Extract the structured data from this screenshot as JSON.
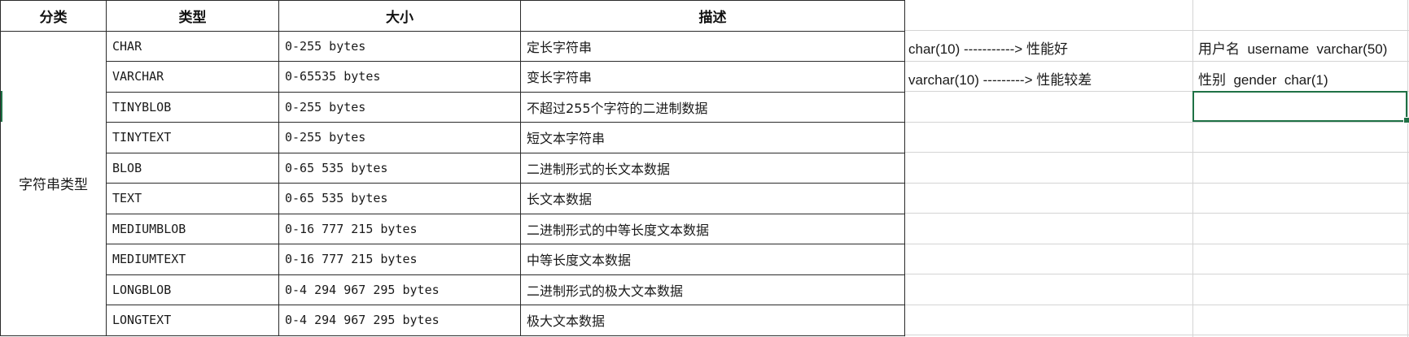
{
  "table": {
    "headers": [
      "分类",
      "类型",
      "大小",
      "描述"
    ],
    "category": "字符串类型",
    "rows": [
      {
        "type": "CHAR",
        "size": "0-255 bytes",
        "desc": "定长字符串"
      },
      {
        "type": "VARCHAR",
        "size": "0-65535 bytes",
        "desc": "变长字符串"
      },
      {
        "type": "TINYBLOB",
        "size": "0-255 bytes",
        "desc": "不超过255个字符的二进制数据"
      },
      {
        "type": "TINYTEXT",
        "size": "0-255 bytes",
        "desc": "短文本字符串"
      },
      {
        "type": "BLOB",
        "size": "0-65 535 bytes",
        "desc": "二进制形式的长文本数据"
      },
      {
        "type": "TEXT",
        "size": "0-65 535 bytes",
        "desc": "长文本数据"
      },
      {
        "type": "MEDIUMBLOB",
        "size": "0-16 777 215 bytes",
        "desc": "二进制形式的中等长度文本数据"
      },
      {
        "type": "MEDIUMTEXT",
        "size": "0-16 777 215 bytes",
        "desc": "中等长度文本数据"
      },
      {
        "type": "LONGBLOB",
        "size": "0-4 294 967 295 bytes",
        "desc": "二进制形式的极大文本数据"
      },
      {
        "type": "LONGTEXT",
        "size": "0-4 294 967 295 bytes",
        "desc": "极大文本数据"
      }
    ]
  },
  "notes": {
    "char_note": "char(10) -----------> 性能好",
    "varchar_note": "varchar(10) ---------> 性能较差",
    "username_example": "用户名  username  varchar(50)",
    "gender_example": "性别  gender  char(1)"
  },
  "colors": {
    "grid": "#d4d4d4",
    "border": "#2a2a2a",
    "selection": "#1e7145"
  }
}
